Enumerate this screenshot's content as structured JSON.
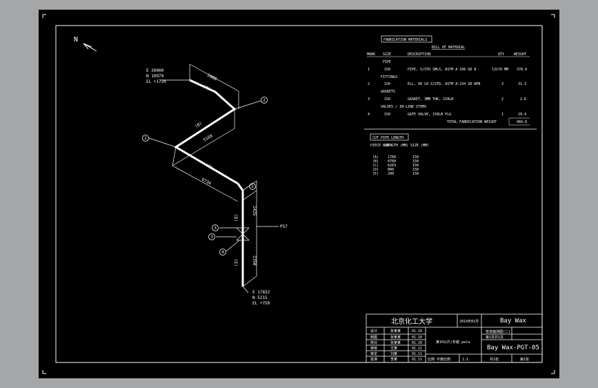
{
  "north_label": "N",
  "start_point": {
    "e": "E 20000",
    "n": "N 10979",
    "el": "EL +1720"
  },
  "end_point": {
    "e": "E 17832",
    "n": "N 5215",
    "el": "EL +750"
  },
  "dimensions": {
    "seg1_len": "2000",
    "seg2_len": "5168",
    "seg3_len": "6734",
    "seg4_len": "1425",
    "seg5_len": "2350",
    "valve_ref": "P57"
  },
  "pipe_labels": {
    "cut_a": "(A)",
    "cut_b": "(B)",
    "cut_c": "(C)",
    "cut_d": "(D)",
    "cut_e": "(E)"
  },
  "bubbles": [
    "1",
    "2",
    "2",
    "2",
    "3",
    "3",
    "4"
  ],
  "fabrication": {
    "title": "FABRICATION MATERIALS",
    "bom_title": "BILL OF MATERIAL",
    "headers": [
      "MARK",
      "SIZE",
      "DESCRIPTION",
      "QTY",
      "WEIGHT"
    ],
    "sections": [
      {
        "label": "PIPE",
        "rows": [
          {
            "mark": "1",
            "size": "150",
            "desc": "PIPE, S/STD SMLS, ASTM A-106 GR B",
            "qty": "13170 MM",
            "weight": "378.4"
          }
        ]
      },
      {
        "label": "FITTINGS",
        "rows": [
          {
            "mark": "2",
            "size": "150",
            "desc": "ELL, 90 LR S/STD, ASTM A-234 GR WPB",
            "qty": "3",
            "weight": "31.3"
          }
        ]
      },
      {
        "label": "GASKETS",
        "rows": [
          {
            "mark": "3",
            "size": "150",
            "desc": "GASKET, 3MM THK, 150LB",
            "qty": "2",
            "weight": "2.6"
          }
        ]
      },
      {
        "label": "VALVES / IN-LINE ITEMS",
        "rows": [
          {
            "mark": "4",
            "size": "150",
            "desc": "GATE VALVE, 150LB FLG",
            "qty": "1",
            "weight": "29.4"
          }
        ]
      }
    ],
    "total_label": "TOTAL FABRICATION WEIGHT",
    "total_value": "484.8"
  },
  "cut_pipe": {
    "title": "CUT PIPE LENGTH",
    "headers": [
      "PIECE NUM",
      "LENGTH (MM)",
      "SIZE (MM)"
    ],
    "rows": [
      [
        "(A)",
        "1760",
        "150"
      ],
      [
        "(B)",
        "4760",
        "150"
      ],
      [
        "(C)",
        "6263",
        "150"
      ],
      [
        "(D)",
        "800",
        "150"
      ],
      [
        "(E)",
        "200",
        "150"
      ]
    ]
  },
  "title_block": {
    "university": "北京化工大学",
    "date": "2014年01月",
    "company": "Bay Wax",
    "drawing_title": "某10公斤/年蜡 pala",
    "drawing_no": "Bay Wax-PGT-05",
    "subtitle1": "管道轴测图(二)",
    "subtitle2": "第1页共1页",
    "left_cells": [
      [
        "设计",
        "张某某",
        "01.10"
      ],
      [
        "制图",
        "张某某",
        "01.10"
      ],
      [
        "校对",
        "张某某",
        "01.10"
      ],
      [
        "审核",
        "王某",
        "01.11"
      ],
      [
        "审定",
        "刘某",
        "01.11"
      ],
      [
        "批准",
        "李某",
        "01.11"
      ]
    ],
    "bottom_mid": "比例 不按比例",
    "bottom_mid2": "1:1",
    "bottom_right1": "共1张",
    "bottom_right2": "第1张"
  },
  "colors": {
    "background": "#000000",
    "line": "#ffffff",
    "frame_gray": "#a5a6a8"
  }
}
